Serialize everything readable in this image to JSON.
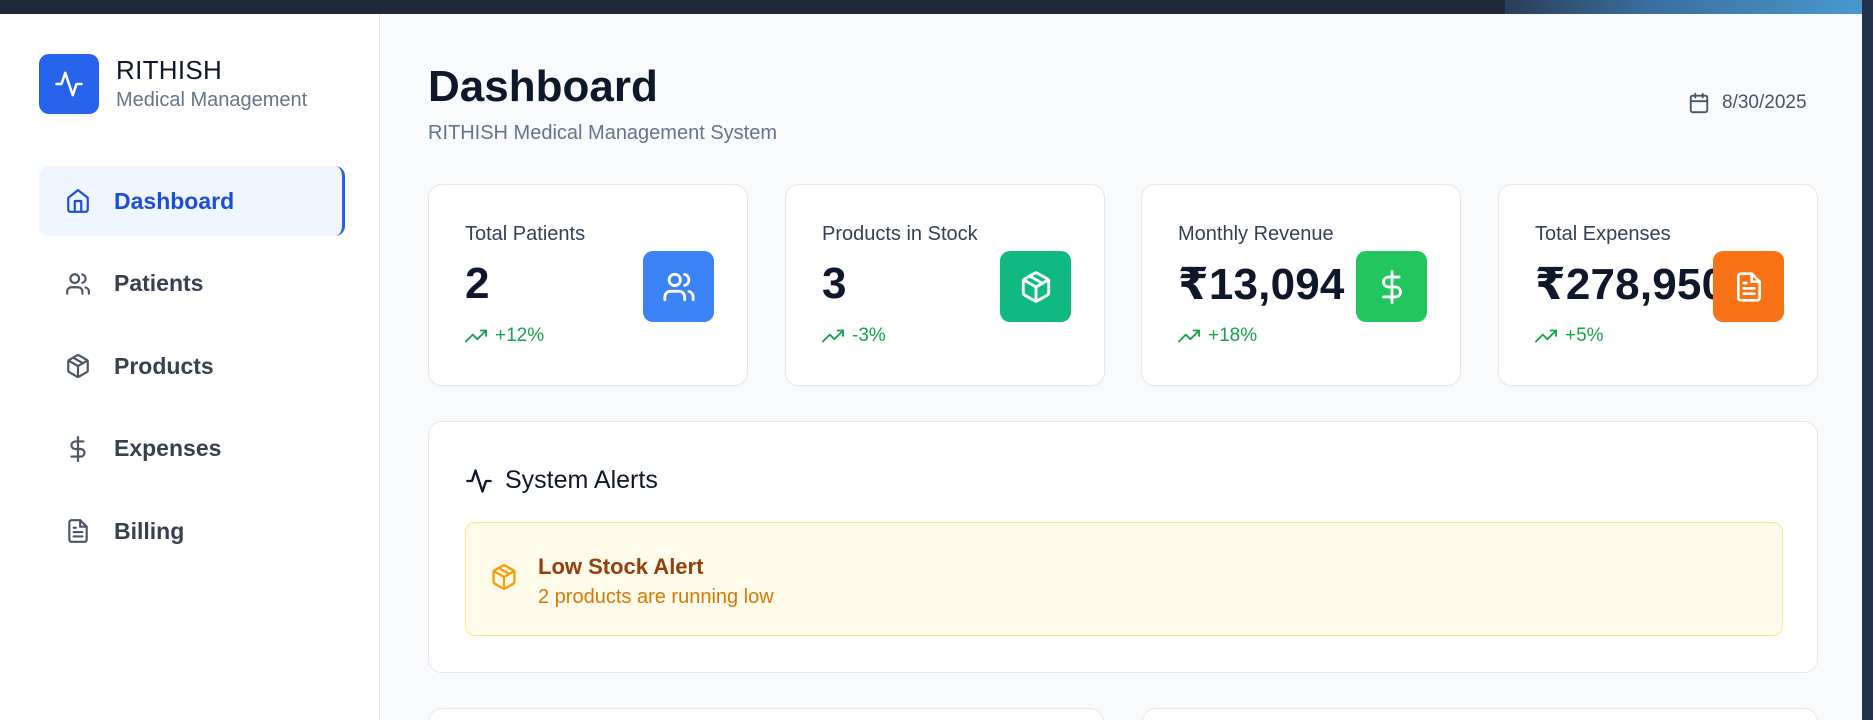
{
  "brand": {
    "name": "RITHISH",
    "subtitle": "Medical Management",
    "icon": "activity-icon"
  },
  "sidebar": {
    "items": [
      {
        "label": "Dashboard",
        "icon": "home-icon",
        "active": true
      },
      {
        "label": "Patients",
        "icon": "users-icon",
        "active": false
      },
      {
        "label": "Products",
        "icon": "package-icon",
        "active": false
      },
      {
        "label": "Expenses",
        "icon": "dollar-icon",
        "active": false
      },
      {
        "label": "Billing",
        "icon": "file-text-icon",
        "active": false
      }
    ]
  },
  "header": {
    "title": "Dashboard",
    "subtitle": "RITHISH Medical Management System",
    "date": "8/30/2025",
    "date_icon": "calendar-icon"
  },
  "stats": [
    {
      "label": "Total Patients",
      "value": "2",
      "trend": "+12%",
      "icon": "users-icon",
      "color": "#3b82f6"
    },
    {
      "label": "Products in Stock",
      "value": "3",
      "trend": "-3%",
      "icon": "package-icon",
      "color": "#10b981"
    },
    {
      "label": "Monthly Revenue",
      "value": "₹13,094",
      "trend": "+18%",
      "icon": "dollar-icon",
      "color": "#22c55e"
    },
    {
      "label": "Total Expenses",
      "value": "₹278,950",
      "trend": "+5%",
      "icon": "file-text-icon",
      "color": "#f97316"
    }
  ],
  "alerts": {
    "title": "System Alerts",
    "icon": "activity-icon",
    "items": [
      {
        "title": "Low Stock Alert",
        "message": "2 products are running low",
        "icon": "package-icon",
        "color": "#f59e0b"
      }
    ]
  },
  "colors": {
    "primary": "#2563eb",
    "active_nav_bg": "#eff6ff",
    "trend_green": "#16a34a",
    "alert_bg": "#fffbeb",
    "alert_border": "#fde68a"
  }
}
